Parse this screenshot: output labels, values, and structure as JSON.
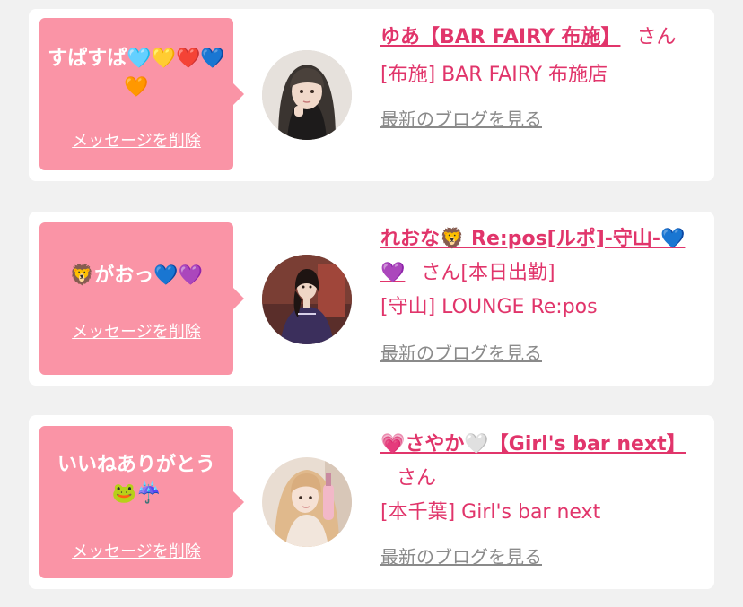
{
  "cards": [
    {
      "message": "すぱすぱ🩵💛❤️💙🧡",
      "delete_label": "メッセージを削除",
      "name": "ゆあ【BAR FAIRY 布施】",
      "honorific": "さん",
      "shop": "[布施] BAR FAIRY 布施店",
      "blog_label": "最新のブログを見る",
      "avatar_icon": "profile-photo"
    },
    {
      "message": "🦁がおっ💙💜",
      "delete_label": "メッセージを削除",
      "name": "れおな🦁 Re:pos[ルポ]-守山-💙💜",
      "honorific": "さん[本日出勤]",
      "shop": "[守山] LOUNGE Re:pos",
      "blog_label": "最新のブログを見る",
      "avatar_icon": "profile-photo"
    },
    {
      "message": "いいねありがとう🐸☔️",
      "delete_label": "メッセージを削除",
      "name": "💗さやか🤍【Girl's bar next】",
      "honorific": "さん",
      "shop": "[本千葉] Girl's bar next",
      "blog_label": "最新のブログを見る",
      "avatar_icon": "profile-photo"
    }
  ],
  "colors": {
    "accent": "#e1356b",
    "bubble": "#fa94a6",
    "background": "#f1f1f1",
    "card": "#ffffff",
    "muted_link": "#8a8a8a"
  }
}
